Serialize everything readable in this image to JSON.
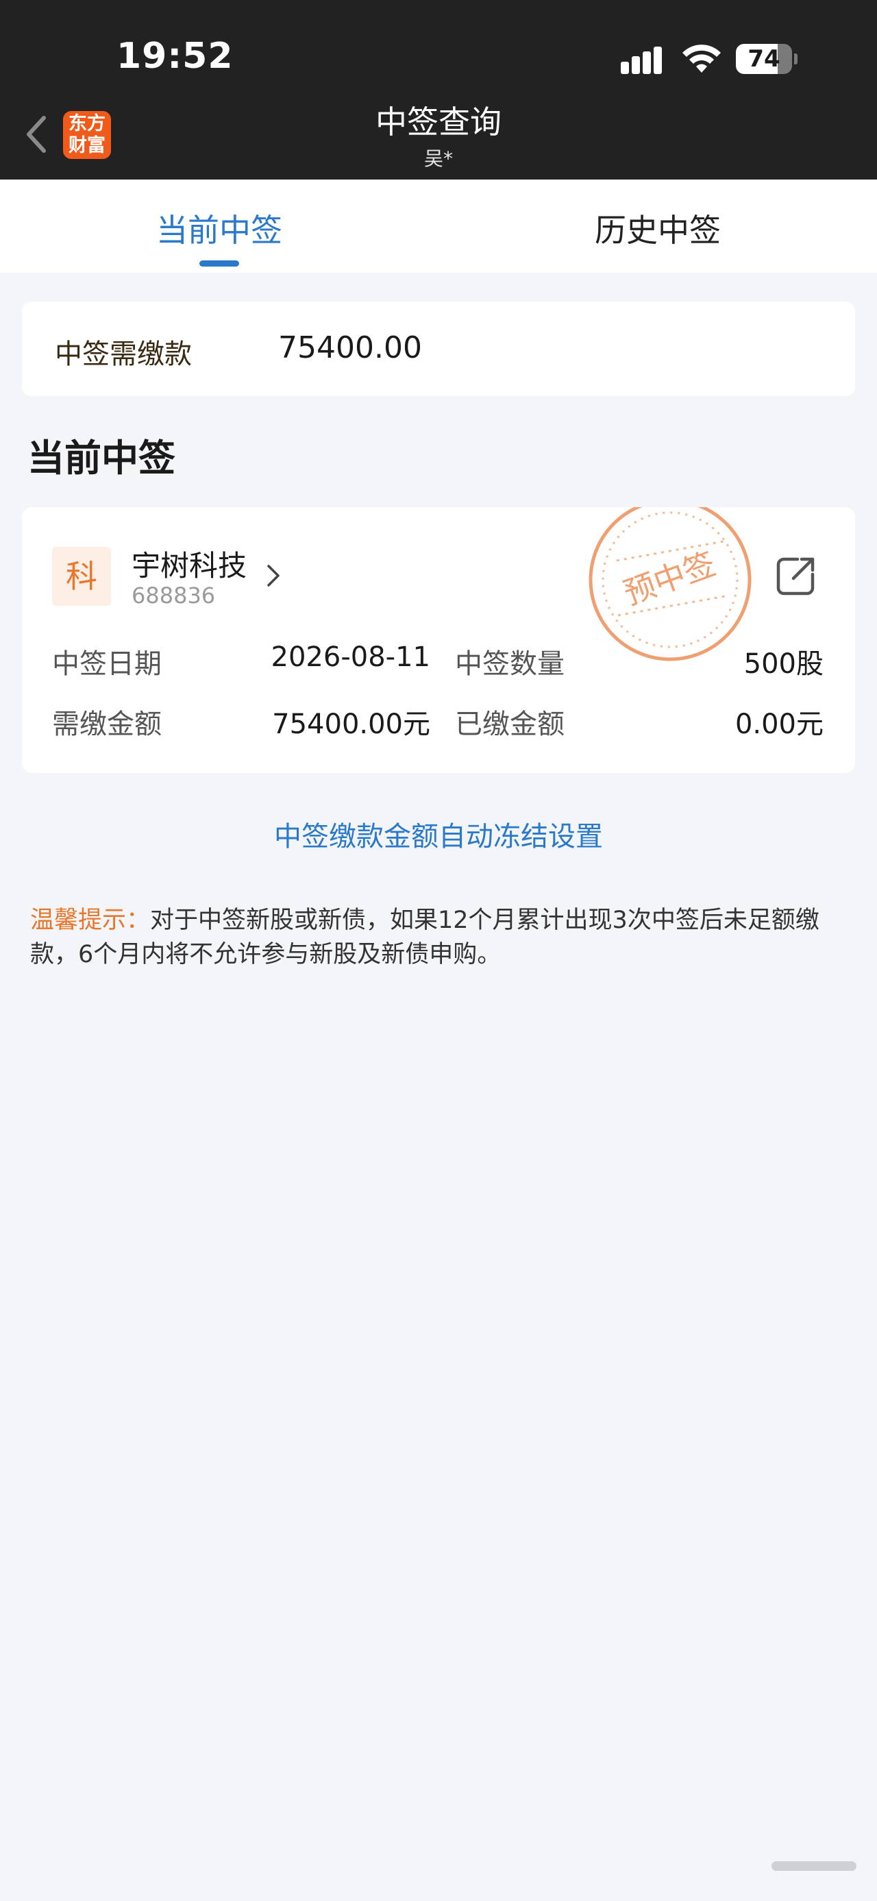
{
  "status_bar": {
    "time": "19:52",
    "battery_level": "74"
  },
  "nav": {
    "brand_logo_line1": "东方",
    "brand_logo_line2": "财富",
    "title": "中签查询",
    "subtitle": "吴*"
  },
  "tabs": [
    {
      "label": "当前中签",
      "active": true
    },
    {
      "label": "历史中签",
      "active": false
    }
  ],
  "summary": {
    "label": "中签需缴款",
    "value": "75400.00"
  },
  "section_title": "当前中签",
  "record": {
    "badge": "科",
    "name": "宇树科技",
    "code": "688836",
    "stamp_text": "预中签",
    "fields": {
      "date_label": "中签日期",
      "date_value": "2026-08-11",
      "qty_label": "中签数量",
      "qty_value": "500股",
      "due_label": "需缴金额",
      "due_value": "75400.00元",
      "paid_label": "已缴金额",
      "paid_value": "0.00元"
    }
  },
  "freeze_setting_link": "中签缴款金额自动冻结设置",
  "tip": {
    "label": "温馨提示：",
    "text": "对于中签新股或新债，如果12个月累计出现3次中签后未足额缴款，6个月内将不允许参与新股及新债申购。"
  },
  "colors": {
    "accent_blue": "#2b79c9",
    "accent_orange": "#e8772e",
    "brand_orange": "#f05a1a",
    "header_bg": "#222222"
  }
}
